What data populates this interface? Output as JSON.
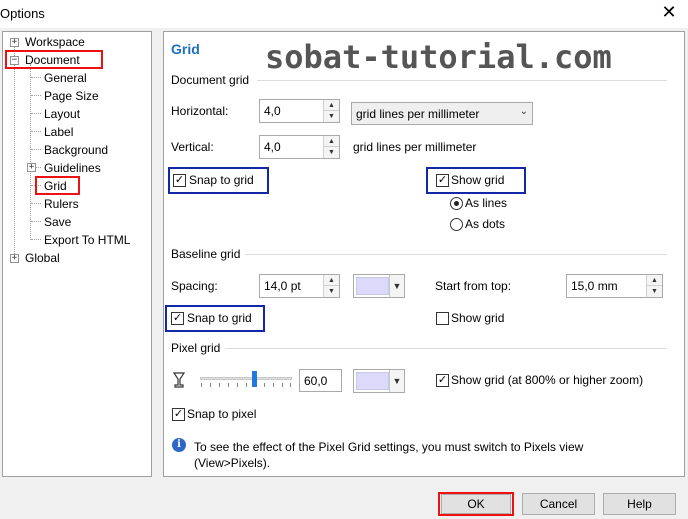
{
  "window": {
    "title": "Options"
  },
  "tree": {
    "workspace": "Workspace",
    "document": "Document",
    "general": "General",
    "page_size": "Page Size",
    "layout": "Layout",
    "label": "Label",
    "background": "Background",
    "guidelines": "Guidelines",
    "grid": "Grid",
    "rulers": "Rulers",
    "save": "Save",
    "export_html": "Export To HTML",
    "global": "Global"
  },
  "panel": {
    "heading": "Grid",
    "watermark": "sobat-tutorial.com"
  },
  "document_grid": {
    "label": "Document grid",
    "horizontal_label": "Horizontal:",
    "horizontal_value": "4,0",
    "unit_selected": "grid lines per millimeter",
    "vertical_label": "Vertical:",
    "vertical_value": "4,0",
    "vertical_unit": "grid lines per millimeter",
    "snap_label": "Snap to grid",
    "show_grid_label": "Show grid",
    "as_lines": "As lines",
    "as_dots": "As dots"
  },
  "baseline_grid": {
    "label": "Baseline grid",
    "spacing_label": "Spacing:",
    "spacing_value": "14,0 pt",
    "start_label": "Start from top:",
    "start_value": "15,0 mm",
    "snap_label": "Snap to grid",
    "show_grid_label": "Show grid"
  },
  "pixel_grid": {
    "label": "Pixel grid",
    "opacity_value": "60,0",
    "opacity_percent": 60,
    "show_grid_label": "Show grid (at 800% or higher zoom)",
    "snap_label": "Snap to pixel",
    "info_line1": "To see the effect of the Pixel Grid settings, you must switch to Pixels view",
    "info_line2": "(View>Pixels)."
  },
  "buttons": {
    "ok": "OK",
    "cancel": "Cancel",
    "help": "Help"
  },
  "colors": {
    "heading": "#1f6fc0",
    "highlight_red": "#e11111",
    "highlight_blue": "#1328a8",
    "grid_color_swatch": "#dcd9fb"
  }
}
